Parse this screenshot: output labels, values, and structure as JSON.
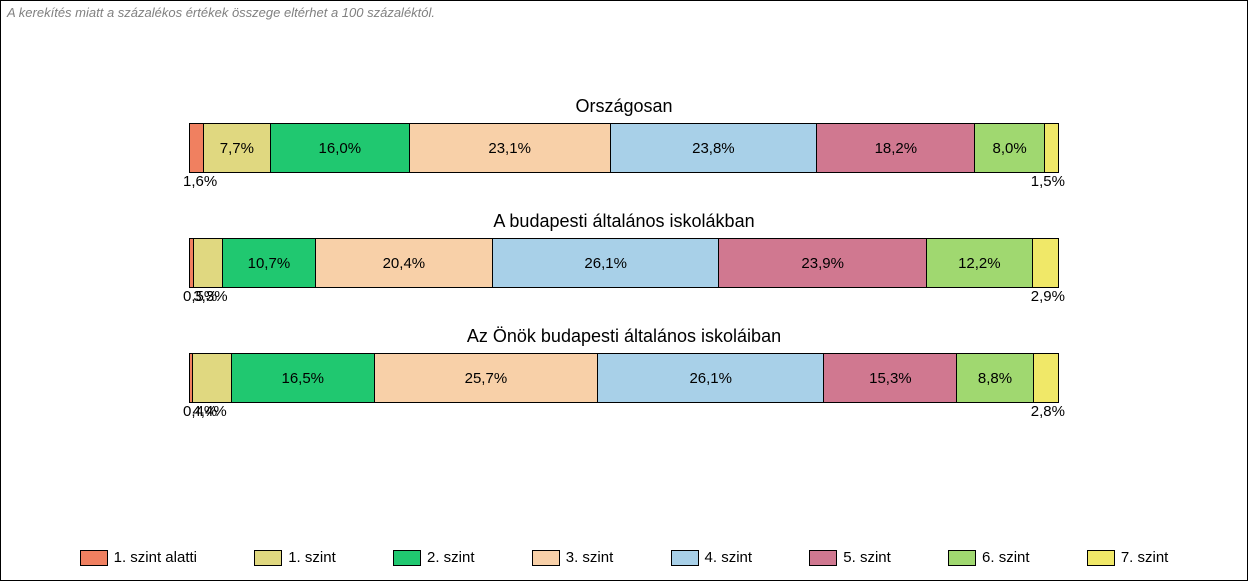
{
  "note": "A kerekítés miatt a százalékos értékek összege eltérhet a 100 százaléktól.",
  "legend": [
    {
      "label": "1. szint alatti",
      "color": "#f08060"
    },
    {
      "label": "1. szint",
      "color": "#e0d880"
    },
    {
      "label": "2. szint",
      "color": "#20c870"
    },
    {
      "label": "3. szint",
      "color": "#f8d0a8"
    },
    {
      "label": "4. szint",
      "color": "#a8d0e8"
    },
    {
      "label": "5. szint",
      "color": "#d07890"
    },
    {
      "label": "6. szint",
      "color": "#a0d870"
    },
    {
      "label": "7. szint",
      "color": "#f0e868"
    }
  ],
  "chart_data": {
    "type": "bar",
    "stacked": true,
    "orientation": "horizontal",
    "unit": "%",
    "categories": [
      "Országosan",
      "A budapesti általános iskolákban",
      "Az Önök budapesti általános iskoláiban"
    ],
    "series": [
      {
        "name": "1. szint alatti",
        "values": [
          1.6,
          0.5,
          0.4
        ]
      },
      {
        "name": "1. szint",
        "values": [
          7.7,
          3.3,
          4.4
        ]
      },
      {
        "name": "2. szint",
        "values": [
          16.0,
          10.7,
          16.5
        ]
      },
      {
        "name": "3. szint",
        "values": [
          23.1,
          20.4,
          25.7
        ]
      },
      {
        "name": "4. szint",
        "values": [
          23.8,
          26.1,
          26.1
        ]
      },
      {
        "name": "5. szint",
        "values": [
          18.2,
          23.9,
          15.3
        ]
      },
      {
        "name": "6. szint",
        "values": [
          8.0,
          12.2,
          8.8
        ]
      },
      {
        "name": "7. szint",
        "values": [
          1.5,
          2.9,
          2.8
        ]
      }
    ],
    "labels": [
      [
        "1,6%",
        "7,7%",
        "16,0%",
        "23,1%",
        "23,8%",
        "18,2%",
        "8,0%",
        "1,5%"
      ],
      [
        "0,5%",
        "3,3%",
        "10,7%",
        "20,4%",
        "26,1%",
        "23,9%",
        "12,2%",
        "2,9%"
      ],
      [
        "0,4%",
        "4,4%",
        "16,5%",
        "25,7%",
        "26,1%",
        "15,3%",
        "8,8%",
        "2,8%"
      ]
    ],
    "external_label_threshold": 5.0
  }
}
